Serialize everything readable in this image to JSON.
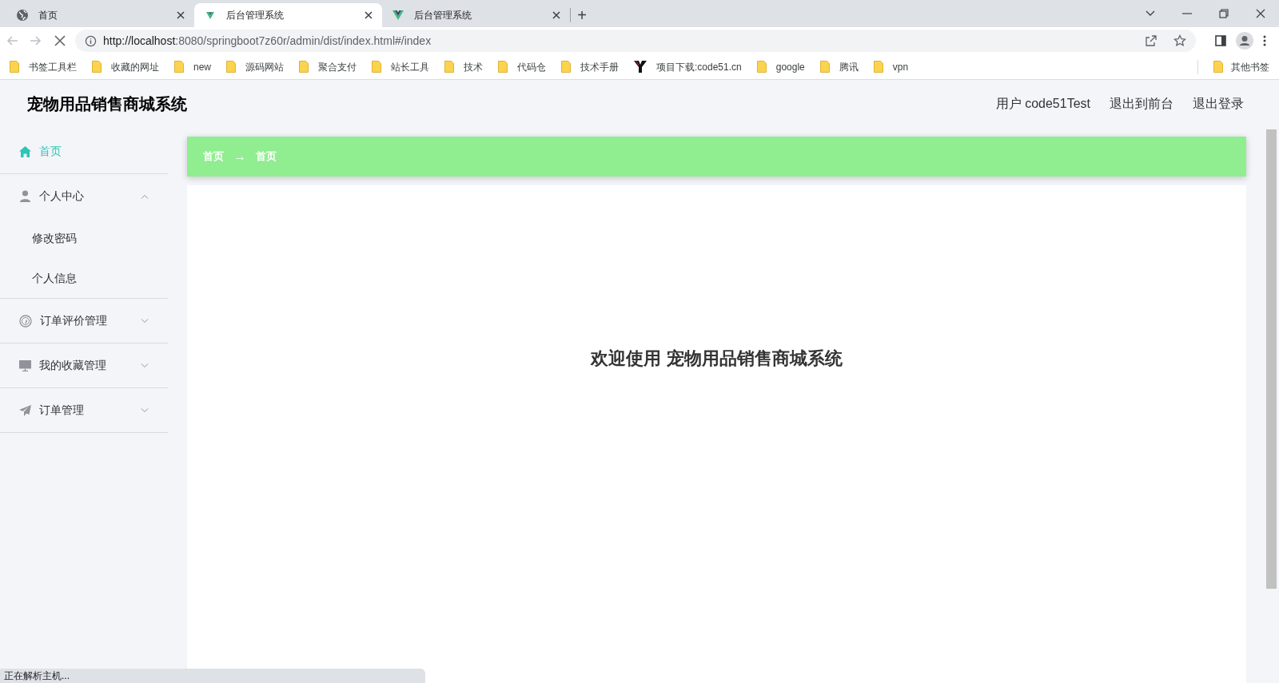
{
  "browser": {
    "tabs": [
      {
        "title": "首页",
        "selected": false
      },
      {
        "title": "后台管理系统",
        "selected": true
      },
      {
        "title": "后台管理系统",
        "selected": false
      }
    ],
    "new_tab": "+",
    "url": {
      "host": "http://localhost",
      "rest": ":8080/springboot7z60r/admin/dist/index.html#/index"
    },
    "bookmarks": [
      {
        "label": "书签工具栏",
        "kind": "folder"
      },
      {
        "label": "收藏的网址",
        "kind": "folder"
      },
      {
        "label": "new",
        "kind": "folder"
      },
      {
        "label": "源码网站",
        "kind": "folder"
      },
      {
        "label": "聚合支付",
        "kind": "folder"
      },
      {
        "label": "站长工具",
        "kind": "folder"
      },
      {
        "label": "技术",
        "kind": "folder"
      },
      {
        "label": "代码仓",
        "kind": "folder"
      },
      {
        "label": "技术手册",
        "kind": "folder"
      },
      {
        "label": "项目下载:code51.cn",
        "kind": "site"
      },
      {
        "label": "google",
        "kind": "folder"
      },
      {
        "label": "腾讯",
        "kind": "folder"
      },
      {
        "label": "vpn",
        "kind": "folder"
      }
    ],
    "other_bookmarks": "其他书签",
    "status_bubble": "正在解析主机..."
  },
  "header": {
    "title": "宠物用品销售商城系统",
    "user": "用户 code51Test",
    "links": [
      "退出到前台",
      "退出登录"
    ]
  },
  "sidebar": {
    "items": [
      {
        "label": "首页",
        "selected": true
      },
      {
        "label": "个人中心",
        "selected": false,
        "expanded": true,
        "children": [
          {
            "label": "修改密码",
            "selected": false
          },
          {
            "label": "个人信息",
            "selected": false
          }
        ]
      },
      {
        "label": "订单评价管理",
        "selected": false,
        "expanded": false
      },
      {
        "label": "我的收藏管理",
        "selected": false,
        "expanded": false
      },
      {
        "label": "订单管理",
        "selected": false,
        "expanded": false
      }
    ]
  },
  "breadcrumb": {
    "items": [
      "首页",
      "首页"
    ],
    "separator": "→"
  },
  "welcome": "欢迎使用 宠物用品销售商城系统"
}
